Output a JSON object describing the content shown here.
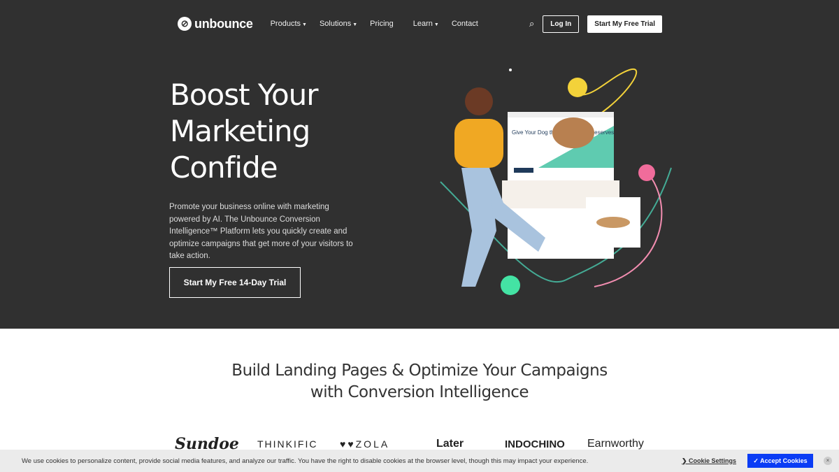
{
  "nav": {
    "logo": "unbounce",
    "items": [
      {
        "label": "Products",
        "dropdown": true
      },
      {
        "label": "Solutions",
        "dropdown": true
      },
      {
        "label": "Pricing",
        "dropdown": false
      },
      {
        "label": "Learn",
        "dropdown": true
      },
      {
        "label": "Contact",
        "dropdown": false
      }
    ],
    "login": "Log In",
    "trial": "Start My Free Trial"
  },
  "hero": {
    "title_lines": [
      "Boost Your",
      "Marketing",
      "Confide"
    ],
    "description": "Promote your business online with marketing powered by AI. The Unbounce Conversion Intelligence™ Platform lets you quickly create and optimize campaigns that get more of your visitors to take action.",
    "cta": "Start My Free 14-Day Trial",
    "mock_headline": "Give Your Dog the Vacation He Deserves"
  },
  "section": {
    "title_line1": "Build Landing Pages & Optimize Your Campaigns",
    "title_line2": "with Conversion Intelligence",
    "logos": [
      "Sundoe",
      "THINKIFIC",
      "ZOLA",
      "Later",
      "INDOCHINO",
      "Earnworthy"
    ]
  },
  "cookie": {
    "text": "We use cookies to personalize content, provide social media features, and analyze our traffic. You have the right to disable cookies at the browser level, though this may impact your experience.",
    "settings": "Cookie Settings",
    "accept": "✓ Accept Cookies",
    "close": "×"
  },
  "colors": {
    "hero_bg": "#303030",
    "accept_blue": "#0a3cf5"
  }
}
